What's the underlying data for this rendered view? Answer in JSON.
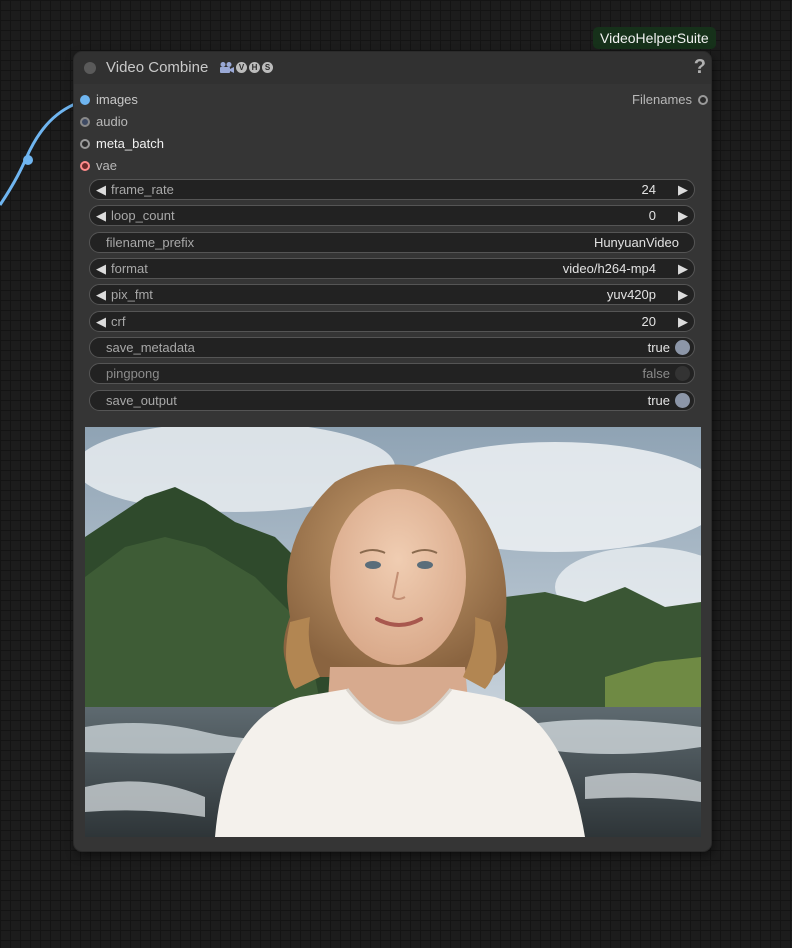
{
  "suite_badge": "VideoHelperSuite",
  "node": {
    "title": "Video Combine",
    "title_icons": [
      "film-camera-icon",
      "V",
      "H",
      "S"
    ],
    "help": "?",
    "inputs": [
      {
        "label": "images",
        "color": "#6fb5f0",
        "connected": true
      },
      {
        "label": "audio",
        "color": "#8a8a8a",
        "connected": false
      },
      {
        "label": "meta_batch",
        "color": "#8a8a8a",
        "connected": false
      },
      {
        "label": "vae",
        "color": "#ff8b8b",
        "connected": false
      }
    ],
    "output": {
      "label": "Filenames",
      "color": "#8a8a8a"
    },
    "widgets": {
      "frame_rate": {
        "label": "frame_rate",
        "value": "24"
      },
      "loop_count": {
        "label": "loop_count",
        "value": "0"
      },
      "filename_prefix": {
        "label": "filename_prefix",
        "value": "HunyuanVideo"
      },
      "format": {
        "label": "format",
        "value": "video/h264-mp4"
      },
      "pix_fmt": {
        "label": "pix_fmt",
        "value": "yuv420p"
      },
      "crf": {
        "label": "crf",
        "value": "20"
      },
      "save_metadata": {
        "label": "save_metadata",
        "value": "true"
      },
      "pingpong": {
        "label": "pingpong",
        "value": "false"
      },
      "save_output": {
        "label": "save_output",
        "value": "true"
      }
    },
    "preview": {
      "content": "video-preview-portrait"
    }
  }
}
